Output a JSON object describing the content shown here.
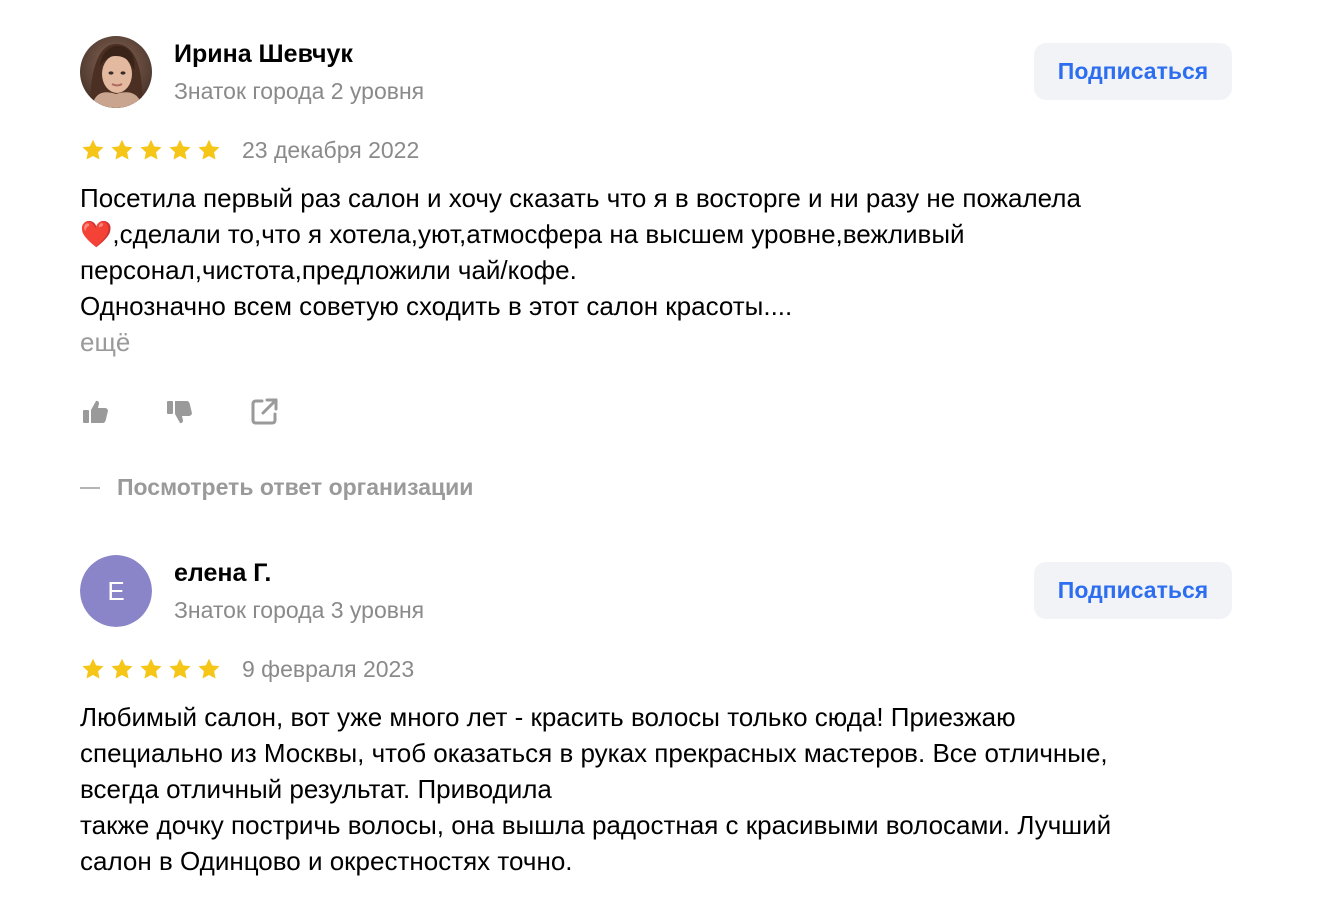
{
  "reviews": [
    {
      "author": "Ирина Шевчук",
      "level": "Знаток города 2 уровня",
      "subscribe_label": "Подписаться",
      "rating": 5,
      "date": "23 декабря 2022",
      "text_line1": "Посетила первый раз салон и хочу сказать что я в восторге и ни разу не пожалела",
      "emoji": "❤️",
      "text_line2": ",сделали то,что я хотела,уют,атмосфера на высшем уровне,вежливый",
      "text_rest": "персонал,чистота,предложили чай/кофе.\nОднозначно всем советую сходить в этот салон красоты....",
      "more_label": "ещё",
      "org_reply_label": "Посмотреть ответ организации"
    },
    {
      "author": "елена Г.",
      "avatar_letter": "Е",
      "level": "Знаток города 3 уровня",
      "subscribe_label": "Подписаться",
      "rating": 5,
      "date": "9 февраля 2023",
      "text": "Любимый салон, вот уже много лет - красить волосы только сюда! Приезжаю\nспециально из Москвы, чтоб оказаться в руках прекрасных мастеров. Все отличные,\nвсегда отличный результат. Приводила\nтакже дочку постричь волосы, она вышла радостная с красивыми волосами. Лучший\nсалон в Одинцово и окрестностях точно."
    }
  ],
  "colors": {
    "accent_blue": "#2d6ef0",
    "star_yellow": "#f5c518",
    "avatar_purple": "#8a85c9",
    "secondary_text": "#8a8a8a",
    "button_bg": "#f2f3f7"
  },
  "icons": {
    "like": "thumbs-up-icon",
    "dislike": "thumbs-down-icon",
    "share": "share-external-icon",
    "star": "star-icon"
  }
}
